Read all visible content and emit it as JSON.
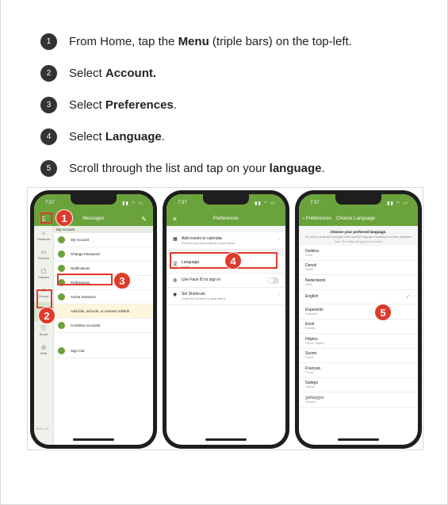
{
  "steps": [
    {
      "num": "1",
      "pre": "From Home, tap the ",
      "bold": "Menu",
      "post": " (triple bars) on the top-left."
    },
    {
      "num": "2",
      "pre": "Select ",
      "bold": "Account.",
      "post": ""
    },
    {
      "num": "3",
      "pre": "Select ",
      "bold": "Preferences",
      "post": "."
    },
    {
      "num": "4",
      "pre": "Select ",
      "bold": "Language",
      "post": "."
    },
    {
      "num": "5",
      "pre": "Scroll through the list and tap on your ",
      "bold": "language",
      "post": "."
    }
  ],
  "phone1": {
    "time": "7:37",
    "nav_title": "Messages",
    "sidebar": [
      {
        "icon": "students-icon",
        "glyph": "⌂",
        "label": "Students"
      },
      {
        "icon": "schools-icon",
        "glyph": "▭",
        "label": "Schools"
      },
      {
        "icon": "classes-icon",
        "glyph": "▢",
        "label": "Classes"
      },
      {
        "icon": "groups-icon",
        "glyph": "☺",
        "label": "Groups"
      },
      {
        "icon": "account-icon",
        "glyph": "☺",
        "label": "Account"
      },
      {
        "icon": "about-icon",
        "glyph": "ⓘ",
        "label": "About"
      },
      {
        "icon": "help-icon",
        "glyph": "◎",
        "label": "Help"
      }
    ],
    "menu_header": "My Account",
    "menu": [
      "My Account",
      "Change Password",
      "Notifications",
      "Preferences",
      "Active Sessions"
    ],
    "banner": "Add kids, schools, or connect Infolink",
    "menu2": [
      "Combine Accounts",
      "Sign Out"
    ],
    "version": "v8.33.1 (1)",
    "badges": [
      "1",
      "2",
      "3"
    ]
  },
  "phone2": {
    "time": "7:37",
    "nav_title": "Preferences",
    "rows": [
      {
        "title": "Add events to calendar",
        "sub": "Events to your school calendar on your device"
      },
      {
        "title": "Language",
        "sub": "English"
      },
      {
        "title": "Use Face ID to sign in",
        "sub": ""
      },
      {
        "title": "Siri Shortcuts",
        "sub": "Enable Siri Shortcuts for quick actions"
      }
    ],
    "badge": "4"
  },
  "phone3": {
    "time": "7:37",
    "nav_back": "Preferences",
    "nav_title": "Choose Language",
    "header_title": "Choose your preferred language.",
    "header_desc": "You will see posts and messages in the selected language if translation has been requested.",
    "header_note": "Note: This setting will apply to all schools.",
    "languages": [
      {
        "name": "Deština",
        "sub": "Czech"
      },
      {
        "name": "Dansk",
        "sub": "Danish"
      },
      {
        "name": "Nederlands",
        "sub": "Dutch"
      },
      {
        "name": "English",
        "sub": ""
      },
      {
        "name": "Esperanto",
        "sub": "Esperanto"
      },
      {
        "name": "Eesti",
        "sub": "Estonian"
      },
      {
        "name": "Filipino",
        "sub": "Filipino, Tagalog"
      },
      {
        "name": "Suomi",
        "sub": "Finnish"
      },
      {
        "name": "Français",
        "sub": "French"
      },
      {
        "name": "Galego",
        "sub": "Galician"
      },
      {
        "name": "ქართული",
        "sub": "Georgian"
      }
    ],
    "badge": "5"
  },
  "colors": {
    "brand": "#6aa23c",
    "annotation": "#e03a2b"
  }
}
